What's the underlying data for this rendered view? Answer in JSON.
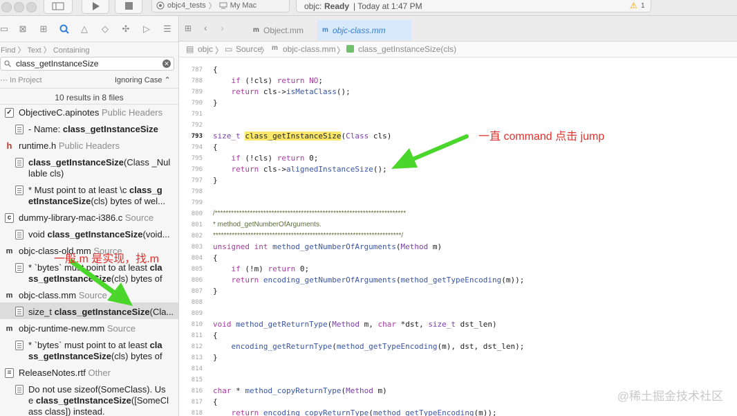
{
  "toolbar": {
    "scheme_project": "objc4_tests",
    "scheme_destination": "My Mac",
    "status_project": "objc:",
    "status_state": "Ready",
    "status_time": "| Today at 1:47 PM",
    "warning_count": "1"
  },
  "find_navigator": {
    "mode_find": "Find",
    "mode_text": "Text",
    "mode_containing": "Containing",
    "query": "class_getInstanceSize",
    "scope": "In Project",
    "case_option": "Ignoring Case",
    "results_summary": "10 results in 8 files"
  },
  "results": [
    {
      "file": "ObjectiveC.apinotes",
      "kind": "Public Headers",
      "icon": "apinotes-file-icon",
      "matches": [
        {
          "pre": "- Name: ",
          "hit": "class_getInstanceSize",
          "post": ""
        }
      ]
    },
    {
      "file": "runtime.h",
      "kind": "Public Headers",
      "icon": "header-file-icon",
      "matches": [
        {
          "l1_hit": "class_getInstanceSize",
          "l1_post": "(Class _Nul",
          "l2": "lable cls)"
        },
        {
          "l1_pre": "*  Must point to at least \\c ",
          "l1_hit": "class_g",
          "l2_hit": "etInstanceSize",
          "l2_post": "(cls) bytes of wel..."
        }
      ]
    },
    {
      "file": "dummy-library-mac-i386.c",
      "kind": "Source",
      "icon": "c-file-icon",
      "matches": [
        {
          "pre": "void ",
          "hit": "class_getInstanceSize",
          "post": "(void..."
        }
      ]
    },
    {
      "file": "objc-class-old.mm",
      "kind": "Source",
      "icon": "mm-file-icon",
      "matches": [
        {
          "l1_pre": "* `bytes` must point to at least ",
          "l1_hit": "cla",
          "l2_hit": "ss_getInstanceSize",
          "l2_post": "(cls) bytes of"
        }
      ]
    },
    {
      "file": "objc-class.mm",
      "kind": "Source",
      "icon": "mm-file-icon",
      "matches": [
        {
          "pre": "size_t ",
          "hit": "class_getInstanceSize",
          "post": "(Cla..."
        }
      ]
    },
    {
      "file": "objc-runtime-new.mm",
      "kind": "Source",
      "icon": "mm-file-icon",
      "matches": [
        {
          "l1_pre": "* `bytes` must point to at least ",
          "l1_hit": "cla",
          "l2_hit": "ss_getInstanceSize",
          "l2_post": "(cls) bytes of"
        }
      ]
    },
    {
      "file": "ReleaseNotes.rtf",
      "kind": "Other",
      "icon": "rtf-file-icon",
      "matches": [
        {
          "l1": "Do not use sizeof(SomeClass). Us",
          "l2_pre": "e ",
          "l2_hit": "class_getInstanceSize",
          "l2_post": "([SomeCl",
          "l3": "ass class]) instead."
        }
      ]
    }
  ],
  "editor": {
    "tabs": [
      "Object.mm",
      "objc-class.mm"
    ],
    "breadcrumb": [
      "objc",
      "Source",
      "objc-class.mm",
      "class_getInstanceSize(cls)"
    ],
    "line_numbers": [
      "787",
      "788",
      "789",
      "790",
      "791",
      "792",
      "793",
      "794",
      "795",
      "796",
      "797",
      "798",
      "799",
      "800",
      "801",
      "802",
      "803",
      "804",
      "805",
      "806",
      "807",
      "808",
      "809",
      "810",
      "811",
      "812",
      "813",
      "814",
      "815",
      "816",
      "817",
      "818"
    ],
    "current_line": "793"
  },
  "annotations": {
    "right_note": "一直 command 点击 jump",
    "left_note": "一般.m 是实现，找.m"
  },
  "watermark": "@稀土掘金技术社区",
  "colors": {
    "annotation_red": "#e0312c",
    "arrow_green": "#4ad62b",
    "highlight_yellow": "#fbe86a",
    "selected_row": "#dcdcdc",
    "active_tab": "#d8e9fb"
  }
}
